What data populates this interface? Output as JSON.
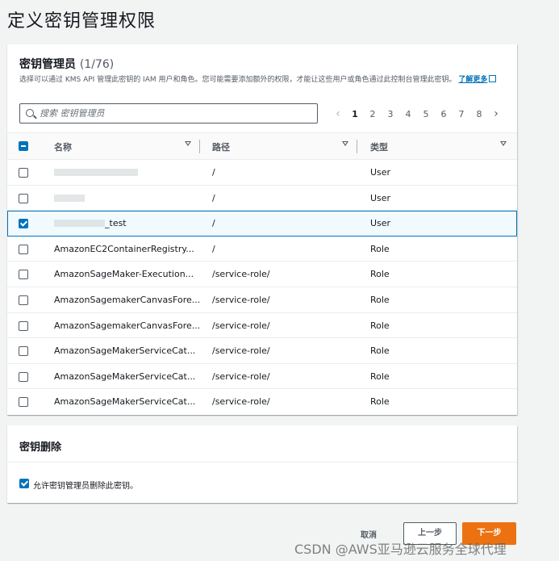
{
  "page": {
    "title": "定义密钥管理权限"
  },
  "admins": {
    "title": "密钥管理员",
    "count": "(1/76)",
    "description": "选择可以通过 KMS API 管理此密钥的 IAM 用户和角色。您可能需要添加额外的权限，才能让这些用户或角色通过此控制台管理此密钥。",
    "learn_more": "了解更多",
    "search_placeholder": "搜索 密钥管理员",
    "pagination": {
      "prev": "‹",
      "pages": [
        "1",
        "2",
        "3",
        "4",
        "5",
        "6",
        "7",
        "8"
      ],
      "next": "›",
      "current": "1"
    },
    "columns": {
      "name": "名称",
      "path": "路径",
      "type": "类型"
    },
    "rows": [
      {
        "name": "",
        "path": "/",
        "type": "User",
        "selected": false
      },
      {
        "name": "",
        "path": "/",
        "type": "User",
        "selected": false
      },
      {
        "name": "_test",
        "path": "/",
        "type": "User",
        "selected": true
      },
      {
        "name": "AmazonEC2ContainerRegistry...",
        "path": "/",
        "type": "Role",
        "selected": false
      },
      {
        "name": "AmazonSageMaker-Execution...",
        "path": "/service-role/",
        "type": "Role",
        "selected": false
      },
      {
        "name": "AmazonSagemakerCanvasFore...",
        "path": "/service-role/",
        "type": "Role",
        "selected": false
      },
      {
        "name": "AmazonSagemakerCanvasFore...",
        "path": "/service-role/",
        "type": "Role",
        "selected": false
      },
      {
        "name": "AmazonSageMakerServiceCat...",
        "path": "/service-role/",
        "type": "Role",
        "selected": false
      },
      {
        "name": "AmazonSageMakerServiceCat...",
        "path": "/service-role/",
        "type": "Role",
        "selected": false
      },
      {
        "name": "AmazonSageMakerServiceCat...",
        "path": "/service-role/",
        "type": "Role",
        "selected": false
      }
    ]
  },
  "deletion": {
    "title": "密钥删除",
    "option_label": "允许密钥管理员删除此密钥。",
    "option_checked": true
  },
  "footer": {
    "cancel": "取消",
    "previous": "上一步",
    "next": "下一步"
  },
  "watermark": "CSDN @AWS亚马逊云服务全球代理",
  "colors": {
    "accent": "#0073bb",
    "primary_button": "#ec7211",
    "background": "#f2f3f3"
  }
}
